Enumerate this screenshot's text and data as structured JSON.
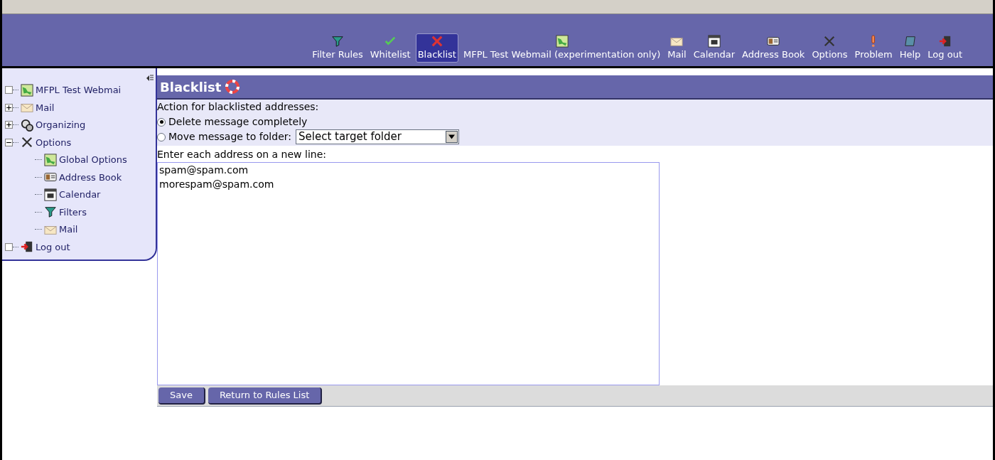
{
  "toolbar": [
    {
      "label": "Filter Rules",
      "selected": false
    },
    {
      "label": "Whitelist",
      "selected": false
    },
    {
      "label": "Blacklist",
      "selected": true
    },
    {
      "label": "MFPL Test Webmail (experimentation only)",
      "selected": false
    },
    {
      "label": "Mail",
      "selected": false
    },
    {
      "label": "Calendar",
      "selected": false
    },
    {
      "label": "Address Book",
      "selected": false
    },
    {
      "label": "Options",
      "selected": false
    },
    {
      "label": "Problem",
      "selected": false
    },
    {
      "label": "Help",
      "selected": false
    },
    {
      "label": "Log out",
      "selected": false
    }
  ],
  "sidebar": {
    "items": [
      {
        "label": "MFPL Test Webmai",
        "kind": "leaf"
      },
      {
        "label": "Mail",
        "kind": "branch",
        "expanded": false
      },
      {
        "label": "Organizing",
        "kind": "branch",
        "expanded": false
      },
      {
        "label": "Options",
        "kind": "branch",
        "expanded": true,
        "children": [
          {
            "label": "Global Options"
          },
          {
            "label": "Address Book"
          },
          {
            "label": "Calendar"
          },
          {
            "label": "Filters"
          },
          {
            "label": "Mail"
          }
        ]
      },
      {
        "label": "Log out",
        "kind": "leaf"
      }
    ]
  },
  "page": {
    "title": "Blacklist",
    "action_label": "Action for blacklisted addresses:",
    "options": [
      {
        "label": "Delete message completely",
        "selected": true,
        "kind": "plain"
      },
      {
        "label": "Move message to folder:",
        "selected": false,
        "kind": "folder",
        "select_value": "Select target folder"
      }
    ],
    "addresses_label": "Enter each address on a new line:",
    "addresses": "spam@spam.com\nmorespam@spam.com",
    "buttons": [
      "Save",
      "Return to Rules List"
    ]
  }
}
